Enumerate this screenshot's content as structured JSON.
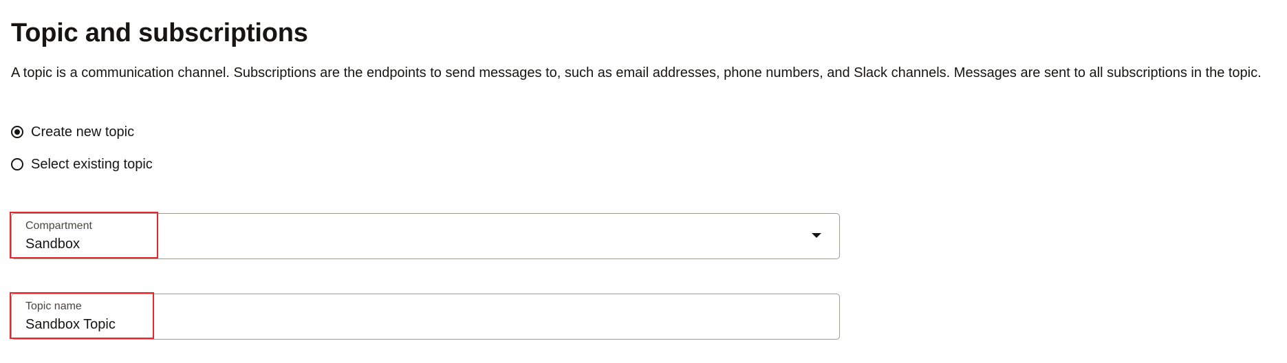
{
  "section": {
    "title": "Topic and subscriptions",
    "description": "A topic is a communication channel. Subscriptions are the endpoints to send messages to, such as email addresses, phone numbers, and Slack channels. Messages are sent to all subscriptions in the topic."
  },
  "topic_mode": {
    "options": [
      {
        "label": "Create new topic",
        "checked": true
      },
      {
        "label": "Select existing topic",
        "checked": false
      }
    ]
  },
  "compartment": {
    "label": "Compartment",
    "value": "Sandbox",
    "icon": "chevron-down-icon"
  },
  "topic_name": {
    "label": "Topic name",
    "value": "Sandbox Topic"
  },
  "annotations": {
    "highlight_color": "#e8262b"
  }
}
